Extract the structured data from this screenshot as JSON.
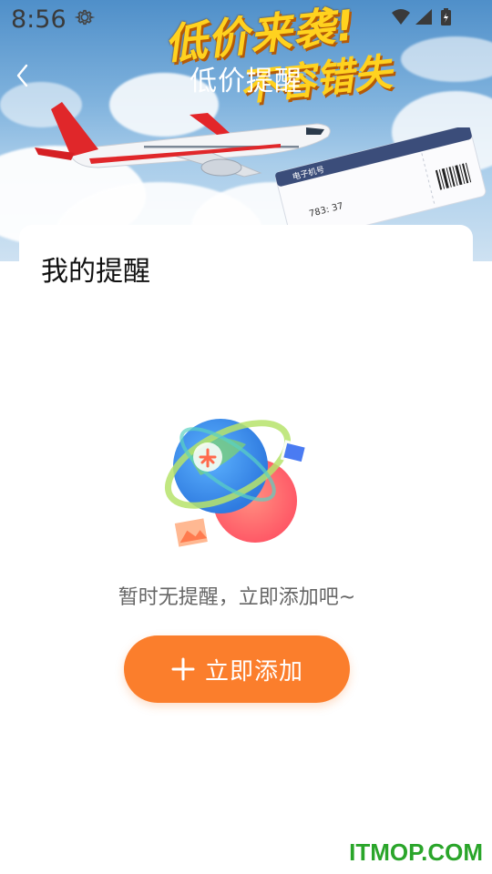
{
  "status_bar": {
    "time": "8:56"
  },
  "header": {
    "title": "低价提醒",
    "back_icon": "chevron-left-icon"
  },
  "banner": {
    "headline": "低价来袭!",
    "subline": "不容错失",
    "ticket": {
      "title": "电子机号",
      "flight": "783: 37"
    }
  },
  "section": {
    "title": "我的提醒"
  },
  "empty_state": {
    "message": "暂时无提醒，立即添加吧~",
    "illustration_icon": "globe-illustration-icon"
  },
  "add_button": {
    "label": "立即添加",
    "icon": "plus-icon"
  },
  "watermark": "ITMOP.COM",
  "colors": {
    "accent": "#fb7e2c",
    "watermark": "#2aa52a",
    "banner_sky": "#4f8fc9"
  }
}
